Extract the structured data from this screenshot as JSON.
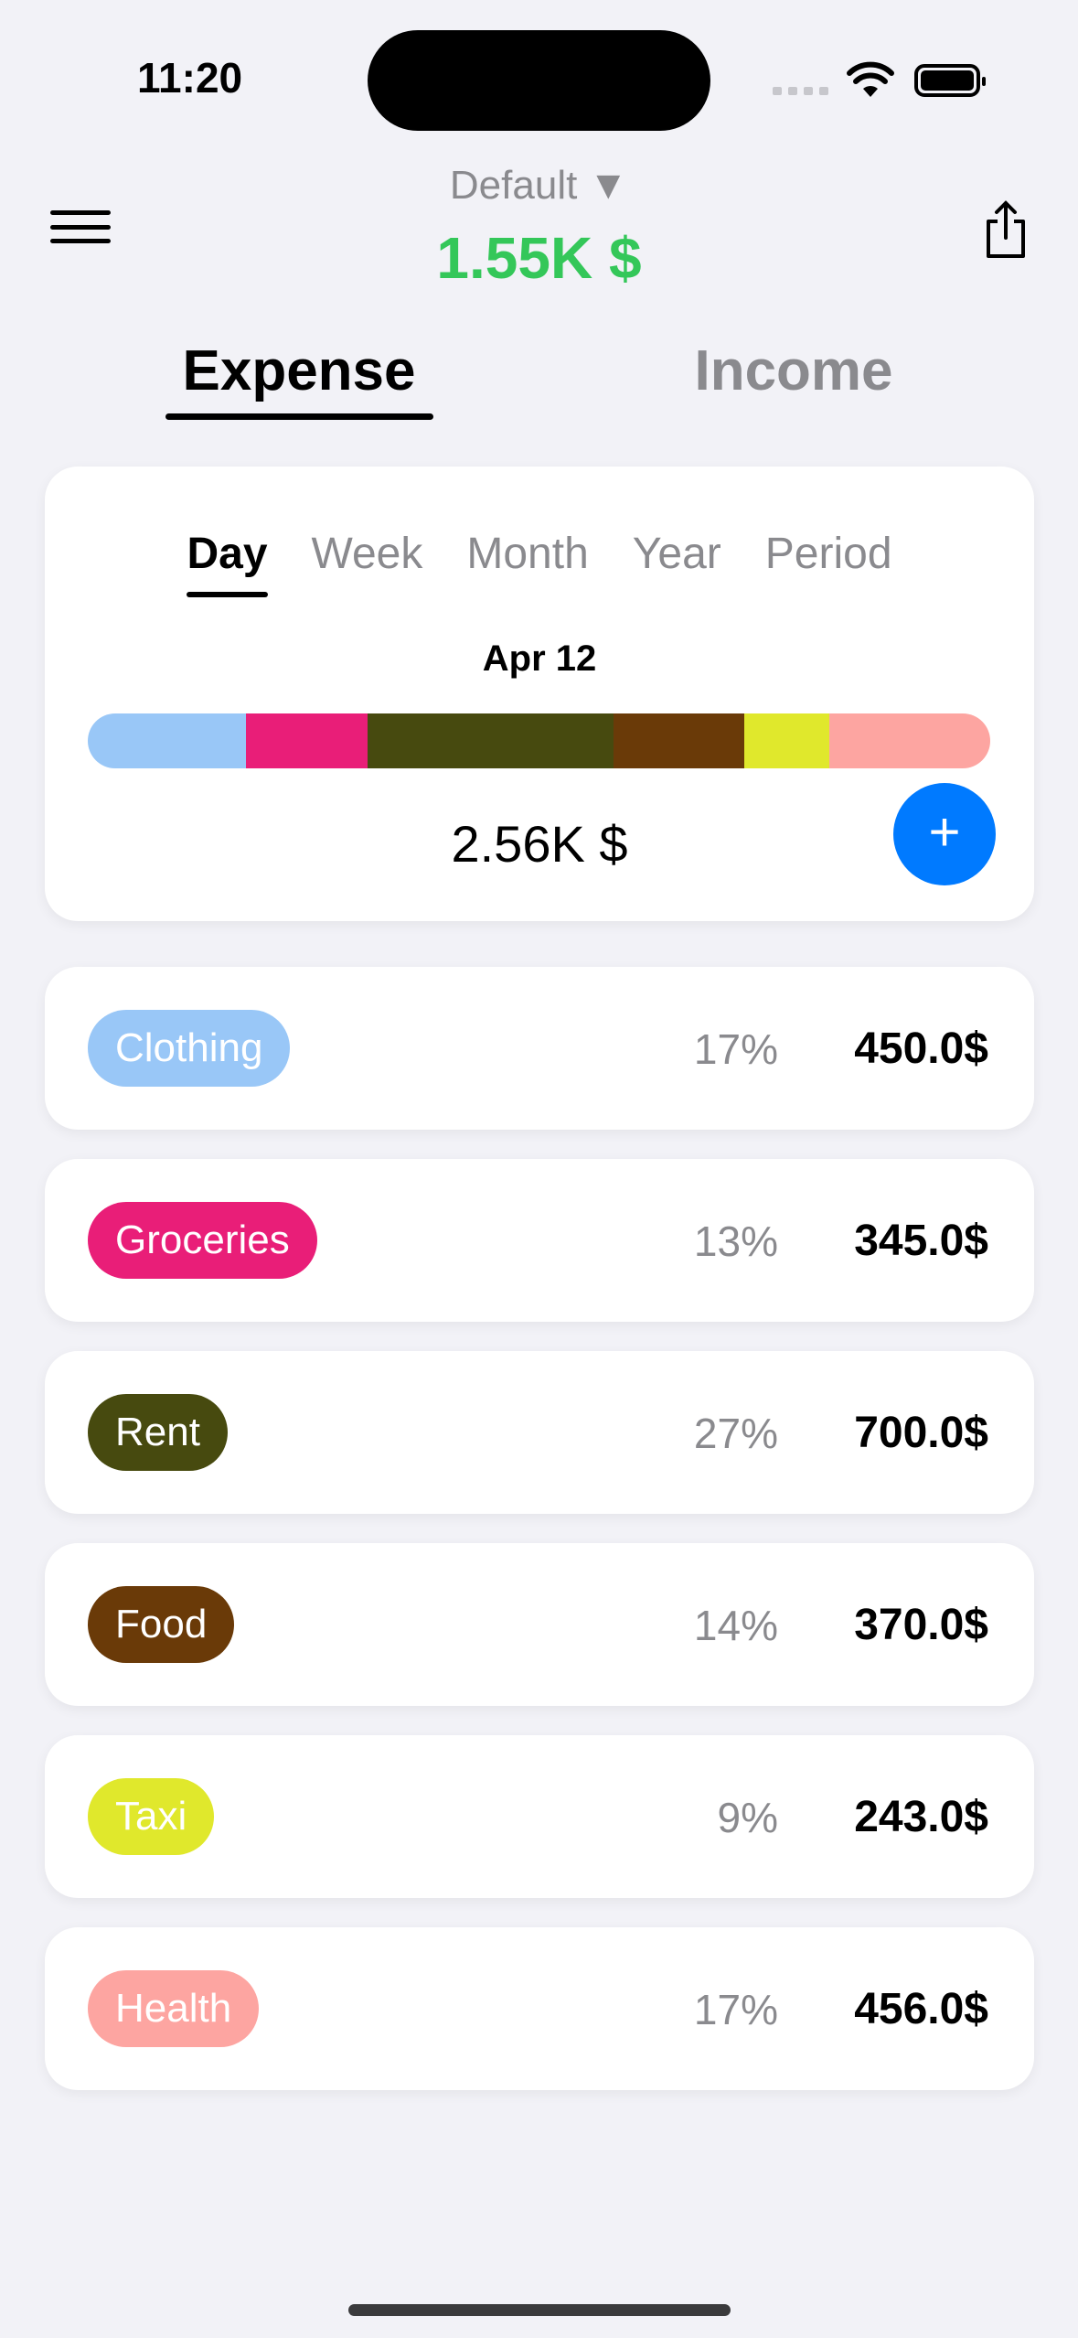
{
  "status": {
    "time": "11:20"
  },
  "header": {
    "account": "Default ▼",
    "balance": "1.55K $"
  },
  "tabs": [
    {
      "label": "Expense",
      "active": true
    },
    {
      "label": "Income",
      "active": false
    }
  ],
  "summary": {
    "periods": [
      "Day",
      "Week",
      "Month",
      "Year",
      "Period"
    ],
    "active_period": "Day",
    "date": "Apr 12",
    "total": "2.56K $",
    "add_label": "+"
  },
  "categories": [
    {
      "name": "Clothing",
      "percent": "17%",
      "amount": "450.0$",
      "value": 450,
      "color": "#99c7f7"
    },
    {
      "name": "Groceries",
      "percent": "13%",
      "amount": "345.0$",
      "value": 345,
      "color": "#e91e78"
    },
    {
      "name": "Rent",
      "percent": "27%",
      "amount": "700.0$",
      "value": 700,
      "color": "#474a0f"
    },
    {
      "name": "Food",
      "percent": "14%",
      "amount": "370.0$",
      "value": 370,
      "color": "#6a3a08"
    },
    {
      "name": "Taxi",
      "percent": "9%",
      "amount": "243.0$",
      "value": 243,
      "color": "#e0e82c"
    },
    {
      "name": "Health",
      "percent": "17%",
      "amount": "456.0$",
      "value": 456,
      "color": "#fda5a1"
    }
  ]
}
